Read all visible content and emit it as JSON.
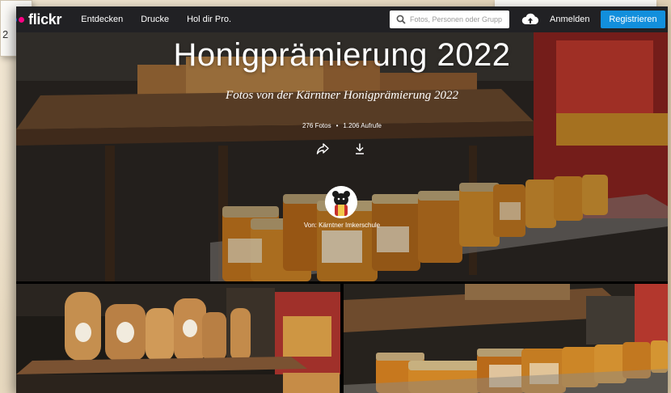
{
  "background": {
    "ghost_card_text": "2"
  },
  "nav": {
    "brand": "flickr",
    "links": [
      "Entdecken",
      "Drucke",
      "Hol dir Pro."
    ],
    "search_placeholder": "Fotos, Personen oder Grupp",
    "login": "Anmelden",
    "signup": "Registrieren"
  },
  "album": {
    "title": "Honigprämierung 2022",
    "subtitle": "Fotos von der Kärntner Honigprämierung 2022",
    "photo_count": "276 Fotos",
    "separator": "•",
    "views": "1.206 Aufrufe",
    "byline": "Von: Kärntner Imkerschule"
  },
  "icons": {
    "share": "share-icon",
    "download": "download-icon",
    "search": "search-icon",
    "upload": "cloud-upload-icon"
  },
  "colors": {
    "nav_bg": "#212124",
    "flickr_blue": "#0063dc",
    "flickr_pink": "#ff0084",
    "signup_bg": "#128fdc",
    "honey": "#c7781e"
  }
}
